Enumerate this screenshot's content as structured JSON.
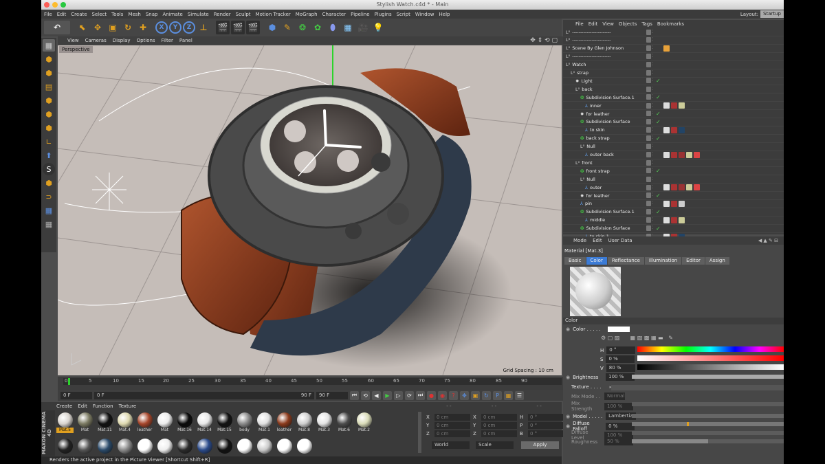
{
  "title": "Stylish Watch.c4d * - Main",
  "menubar": [
    "File",
    "Edit",
    "Create",
    "Select",
    "Tools",
    "Mesh",
    "Snap",
    "Animate",
    "Simulate",
    "Render",
    "Sculpt",
    "Motion Tracker",
    "MoGraph",
    "Character",
    "Pipeline",
    "Plugins",
    "Script",
    "Window",
    "Help"
  ],
  "layout": {
    "label": "Layout:",
    "value": "Startup"
  },
  "toolbar": {
    "x": "X",
    "y": "Y",
    "z": "Z"
  },
  "viewport": {
    "menu": [
      "View",
      "Cameras",
      "Display",
      "Options",
      "Filter",
      "Panel"
    ],
    "label": "Perspective",
    "grid_spacing": "Grid Spacing : 10 cm"
  },
  "timeline": {
    "ticks": [
      "0",
      "5",
      "10",
      "15",
      "20",
      "25",
      "30",
      "35",
      "40",
      "45",
      "50",
      "55",
      "60",
      "65",
      "70",
      "75",
      "80",
      "85",
      "90"
    ],
    "end_frame": "1 F",
    "current": "0 F",
    "start": "0 F",
    "preview_end": "90 F",
    "end": "90 F"
  },
  "materials": {
    "menu": [
      "Create",
      "Edit",
      "Function",
      "Texture"
    ],
    "brand": "MAXON CINEMA 4D",
    "row1": [
      {
        "name": "Mat.5",
        "color": "#d9d4ce",
        "selected": true
      },
      {
        "name": "Mat",
        "color": "#7b7a62",
        "selected": false
      },
      {
        "name": "Mat.11",
        "color": "#111111",
        "selected": false
      },
      {
        "name": "Mat.4",
        "color": "#ded9b0",
        "selected": false
      },
      {
        "name": "leather",
        "color": "#a5452a",
        "selected": false
      },
      {
        "name": "Mat",
        "color": "#ececec",
        "selected": false
      },
      {
        "name": "Mat.16",
        "color": "#0a0a0a",
        "selected": false
      },
      {
        "name": "Mat.14",
        "color": "#e8e8e8",
        "selected": false
      },
      {
        "name": "Mat.15",
        "color": "#121212",
        "selected": false
      },
      {
        "name": "body",
        "color": "#8a8a8a",
        "selected": false
      },
      {
        "name": "Mat.1",
        "color": "#e0e0e0",
        "selected": false
      },
      {
        "name": "leather",
        "color": "#8b3a1c",
        "selected": false
      },
      {
        "name": "Mat.8",
        "color": "#cfcfcf",
        "selected": false
      },
      {
        "name": "Mat.3",
        "color": "#e4e4e4",
        "selected": false
      },
      {
        "name": "Mat.6",
        "color": "#4c4c4c",
        "selected": false
      },
      {
        "name": "Mat.2",
        "color": "#d9dbb8",
        "selected": false
      }
    ],
    "row2": [
      "#222",
      "#555",
      "#2a4a6a",
      "#8a8a8a",
      "#fff",
      "#eee",
      "#2b2b2b",
      "#2a4a8a",
      "#111",
      "#fff",
      "#ccc",
      "#fff",
      "#fff"
    ]
  },
  "coords": {
    "rows": [
      {
        "a": "X",
        "av": "0 cm",
        "b": "X",
        "bv": "0 cm",
        "c": "H",
        "cv": "0 °"
      },
      {
        "a": "Y",
        "av": "0 cm",
        "b": "Y",
        "bv": "0 cm",
        "c": "P",
        "cv": "0 °"
      },
      {
        "a": "Z",
        "av": "0 cm",
        "b": "Z",
        "bv": "0 cm",
        "c": "B",
        "cv": "0 °"
      }
    ],
    "mode": "World",
    "scale": "Scale",
    "apply": "Apply"
  },
  "status": "Renders the active project in the Picture Viewer [Shortcut Shift+R]",
  "objects": {
    "menu": [
      "File",
      "Edit",
      "View",
      "Objects",
      "Tags",
      "Bookmarks"
    ],
    "rows": [
      {
        "name": "------------------------",
        "indent": 0,
        "icon": "null",
        "check": false,
        "tags": []
      },
      {
        "name": "------------------------",
        "indent": 0,
        "icon": "null",
        "check": false,
        "tags": []
      },
      {
        "name": "Scene By Glen Johnson",
        "indent": 0,
        "icon": "null",
        "check": false,
        "tags": [
          "#e8a23a"
        ]
      },
      {
        "name": "------------------------",
        "indent": 0,
        "icon": "null",
        "check": false,
        "tags": []
      },
      {
        "name": "Watch",
        "indent": 0,
        "icon": "null",
        "check": false,
        "tags": []
      },
      {
        "name": "strap",
        "indent": 1,
        "icon": "null",
        "check": false,
        "tags": []
      },
      {
        "name": "Light",
        "indent": 2,
        "icon": "light",
        "check": true,
        "tags": []
      },
      {
        "name": "back",
        "indent": 2,
        "icon": "null",
        "check": false,
        "tags": []
      },
      {
        "name": "Subdivision Surface.1",
        "indent": 3,
        "icon": "sds",
        "check": true,
        "tags": []
      },
      {
        "name": "inner",
        "indent": 4,
        "icon": "poly",
        "check": false,
        "tags": [
          "#ddd",
          "#a33",
          "#cc9"
        ]
      },
      {
        "name": "for leather",
        "indent": 3,
        "icon": "light",
        "check": true,
        "tags": []
      },
      {
        "name": "Subdivision Surface",
        "indent": 3,
        "icon": "sds",
        "check": true,
        "tags": []
      },
      {
        "name": "to skin",
        "indent": 4,
        "icon": "poly",
        "check": false,
        "tags": [
          "#ddd",
          "#a33",
          "#246"
        ]
      },
      {
        "name": "back strap",
        "indent": 3,
        "icon": "sds",
        "check": true,
        "tags": []
      },
      {
        "name": "Null",
        "indent": 3,
        "icon": "null",
        "check": false,
        "tags": []
      },
      {
        "name": "outer back",
        "indent": 4,
        "icon": "poly",
        "check": false,
        "tags": [
          "#ddd",
          "#a33",
          "#933",
          "#cc9",
          "#d44"
        ]
      },
      {
        "name": "front",
        "indent": 2,
        "icon": "null",
        "check": false,
        "tags": []
      },
      {
        "name": "front strap",
        "indent": 3,
        "icon": "sds",
        "check": true,
        "tags": []
      },
      {
        "name": "Null",
        "indent": 3,
        "icon": "null",
        "check": false,
        "tags": []
      },
      {
        "name": "outer",
        "indent": 4,
        "icon": "poly",
        "check": false,
        "tags": [
          "#ddd",
          "#a33",
          "#933",
          "#cc9",
          "#d44"
        ]
      },
      {
        "name": "for leather",
        "indent": 3,
        "icon": "light",
        "check": true,
        "tags": []
      },
      {
        "name": "pin",
        "indent": 3,
        "icon": "poly",
        "check": false,
        "tags": [
          "#ddd",
          "#a33",
          "#ccc"
        ]
      },
      {
        "name": "Subdivision Surface.1",
        "indent": 3,
        "icon": "sds",
        "check": true,
        "tags": []
      },
      {
        "name": "middle",
        "indent": 4,
        "icon": "poly",
        "check": false,
        "tags": [
          "#ddd",
          "#a33",
          "#cc9"
        ]
      },
      {
        "name": "Subdivision Surface",
        "indent": 3,
        "icon": "sds",
        "check": true,
        "tags": []
      },
      {
        "name": "to skin.1",
        "indent": 4,
        "icon": "poly",
        "check": false,
        "tags": [
          "#ddd",
          "#a33",
          "#246"
        ]
      }
    ]
  },
  "attributes": {
    "menu": [
      "Mode",
      "Edit",
      "User Data"
    ],
    "title": "Material [Mat.3]",
    "tabs": [
      "Basic",
      "Color",
      "Reflectance",
      "Illumination",
      "Editor",
      "Assign"
    ],
    "active_tab": "Color",
    "section": "Color",
    "color_label": "Color . . . . .",
    "h": {
      "label": "H",
      "value": "0 °"
    },
    "s": {
      "label": "S",
      "value": "0 %"
    },
    "v": {
      "label": "V",
      "value": "80 %"
    },
    "brightness": {
      "label": "Brightness",
      "value": "100 %",
      "level": 1.0
    },
    "texture": "Texture . . . .",
    "mix_mode": {
      "label": "Mix Mode . .",
      "value": "Normal"
    },
    "mix_strength": {
      "label": "Mix Strength",
      "value": "100 %"
    },
    "model": {
      "label": "Model . . . . .",
      "value": "Lambertian"
    },
    "diffuse_falloff": {
      "label": "Diffuse Falloff",
      "value": "0 %",
      "level": 0.0
    },
    "diffuse_level": {
      "label": "Diffuse Level",
      "value": "100 %"
    },
    "roughness": {
      "label": "Roughness",
      "value": "50 %",
      "level": 0.5
    }
  },
  "colors": {
    "accent": "#3b7bd6",
    "selected": "#e0a020",
    "check": "#55cc55"
  }
}
